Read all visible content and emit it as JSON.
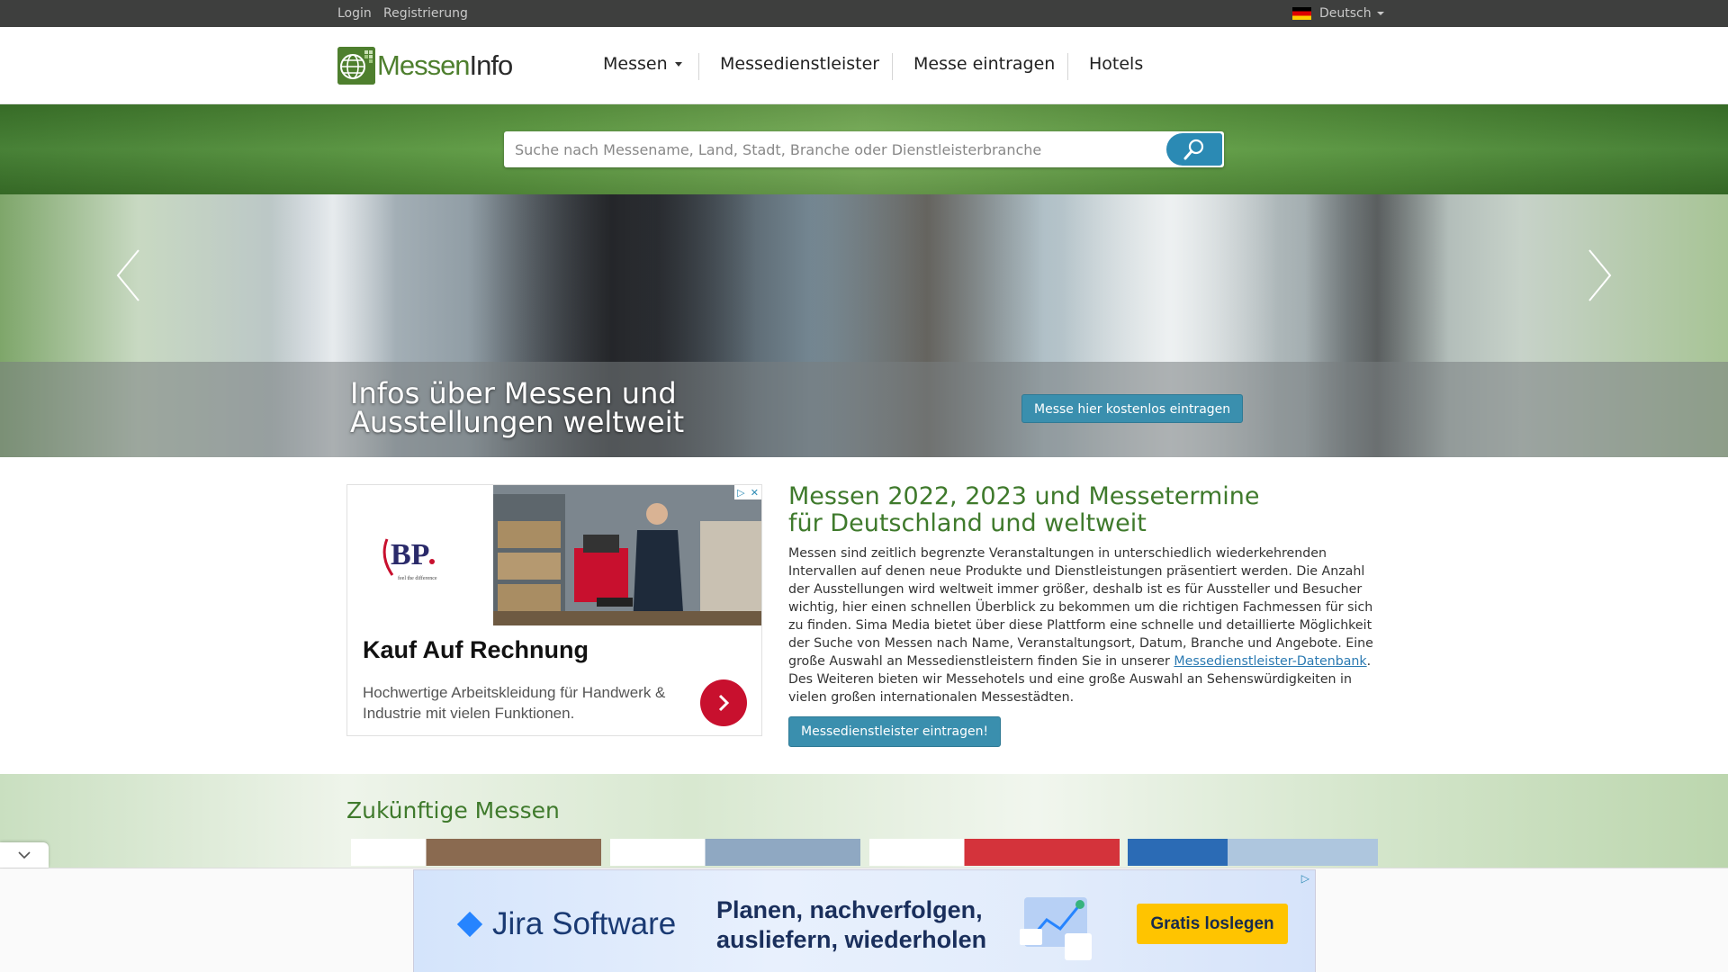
{
  "topbar": {
    "login": "Login",
    "register": "Registrierung",
    "language": "Deutsch"
  },
  "logo": {
    "part1": "Messen",
    "part2": "Info"
  },
  "nav": {
    "items": [
      {
        "label": "Messen"
      },
      {
        "label": "Messedienstleister"
      },
      {
        "label": "Messe eintragen"
      },
      {
        "label": "Hotels"
      }
    ]
  },
  "search": {
    "placeholder": "Suche nach Messename, Land, Stadt, Branche oder Dienstleisterbranche",
    "icon": "search-icon"
  },
  "hero": {
    "title": "Infos über Messen und Ausstellungen weltweit",
    "button": "Messe hier kostenlos eintragen"
  },
  "ad": {
    "brand": "BP.",
    "brand_tagline": "feel the difference",
    "title": "Kauf Auf Rechnung",
    "description": "Hochwertige Arbeitskleidung für Handwerk & Industrie mit vielen Funktionen."
  },
  "main": {
    "heading": "Messen 2022, 2023 und Messetermine für Deutschland und weltweit",
    "text_before_link": "Messen sind zeitlich begrenzte Veranstaltungen in unterschiedlich wiederkehrenden Intervallen auf denen neue Produkte und Dienstleistungen präsentiert werden. Die Anzahl der Ausstellungen wird weltweit immer größer, deshalb ist es für Aussteller und Besucher wichtig, hier einen schnellen Überblick zu bekommen um die richtigen Fachmessen für sich zu finden. Sima Media bietet über diese Plattform eine schnelle und detaillierte Möglichkeit der Suche von Messen nach Name, Veranstaltungsort, Datum, Branche und Angebote. Eine große Auswahl an Messedienstleistern finden Sie in unserer ",
    "link": "Messedienstleister-Datenbank",
    "text_after_link": ". Des Weiteren bieten wir Messehotels und eine große Auswahl an Sehenswürdigkeiten in vielen großen internationalen Messestädten.",
    "button": "Messedienstleister eintragen!"
  },
  "future": {
    "title": "Zukünftige Messen"
  },
  "bottom_ad": {
    "brand": "Jira Software",
    "text": "Planen, nachverfolgen, ausliefern, wiederholen",
    "button": "Gratis loslegen"
  },
  "colors": {
    "brand_green": "#3f7a2c",
    "button_blue": "#3a8fae",
    "topbar": "#3e3f3e",
    "ad_red": "#c8102e",
    "jira_yellow": "#ffc400"
  }
}
